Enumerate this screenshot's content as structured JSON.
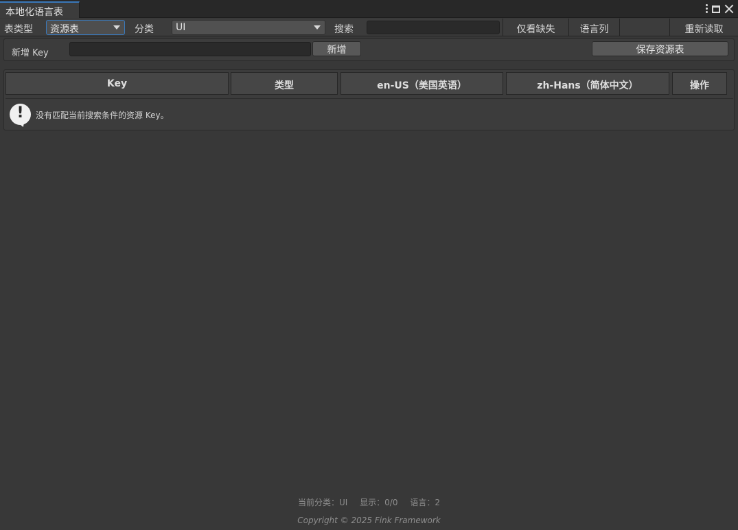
{
  "window": {
    "tab_title": "本地化语言表"
  },
  "toolbar": {
    "table_type_label": "表类型",
    "table_type_value": "资源表",
    "category_label": "分类",
    "category_value": "UI",
    "search_label": "搜索",
    "search_value": "",
    "missing_only_label": "仅看缺失",
    "language_columns_label": "语言列",
    "reload_label": "重新读取"
  },
  "add_row": {
    "new_key_label": "新增 Key",
    "new_key_value": "",
    "add_button_label": "新增",
    "save_button_label": "保存资源表"
  },
  "table": {
    "columns": [
      "Key",
      "类型",
      "en-US（美国英语）",
      "zh-Hans（简体中文）",
      "操作"
    ],
    "empty_message": "没有匹配当前搜索条件的资源 Key。"
  },
  "footer": {
    "current_category": "当前分类：UI",
    "display_count": "显示：0/0",
    "language_count": "语言：2",
    "copyright": "Copyright © 2025 Fink Framework"
  },
  "colors": {
    "background": "#383838",
    "accent": "#3a79bb"
  },
  "icons": [
    "more-vert-icon",
    "maximize-icon",
    "close-icon",
    "alert-icon",
    "dropdown-arrow-icon"
  ]
}
